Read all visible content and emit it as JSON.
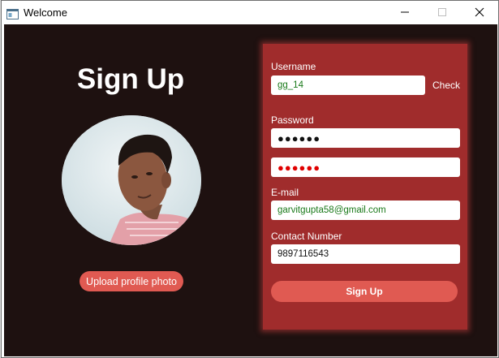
{
  "window": {
    "title": "Welcome",
    "minimize_icon": "minimize-icon",
    "maximize_icon": "maximize-icon",
    "close_icon": "close-icon"
  },
  "left": {
    "heading": "Sign Up",
    "avatar_icon": "profile-photo",
    "upload_label": "Upload profile photo"
  },
  "form": {
    "username_label": "Username",
    "username_value": "gg_14",
    "check_label": "Check",
    "password_label": "Password",
    "password_value": "●●●●●●",
    "confirm_password_value": "●●●●●●",
    "email_label": "E-mail",
    "email_value": "garvitgupta58@gmail.com",
    "contact_label": "Contact Number",
    "contact_value": "9897116543",
    "submit_label": "Sign Up"
  },
  "colors": {
    "background": "#1e1110",
    "panel": "#a02c2c",
    "accent_button": "#e05a52",
    "valid_text": "#1a7a1a",
    "mismatch_text": "#e00000"
  }
}
